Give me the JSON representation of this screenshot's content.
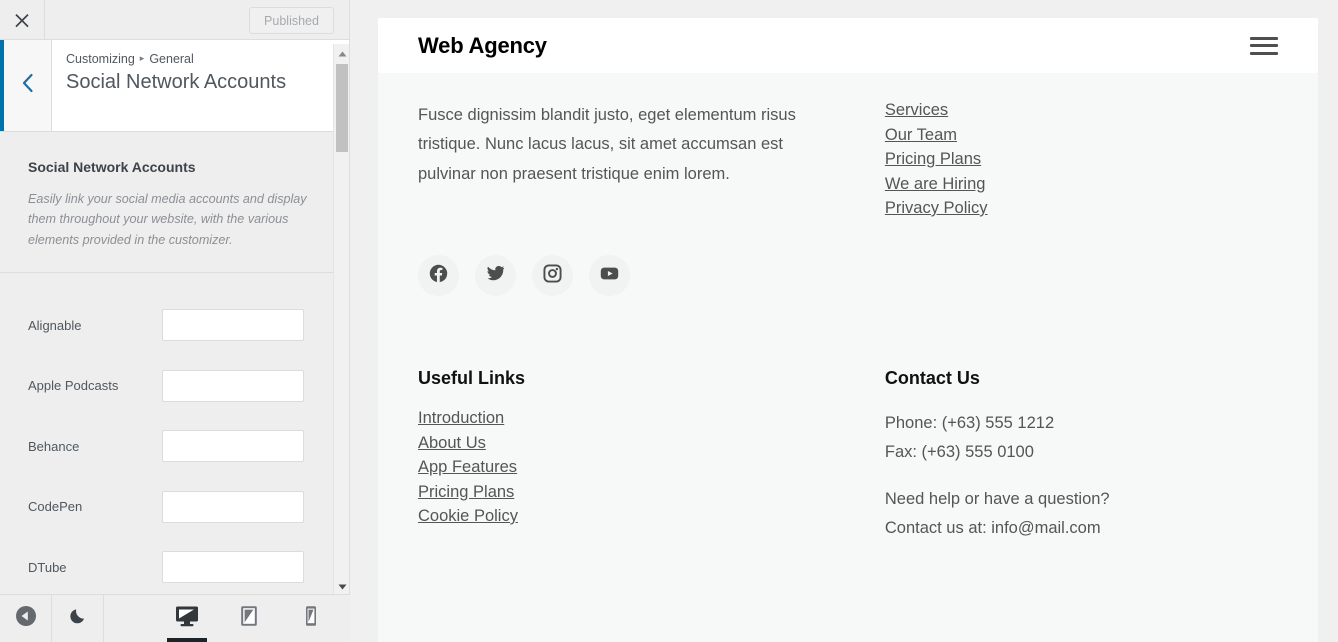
{
  "customizer": {
    "close_label": "close-icon",
    "publish_button": "Published",
    "breadcrumb": {
      "root": "Customizing",
      "separator": "▸",
      "section": "General"
    },
    "panel_title": "Social Network Accounts",
    "description": {
      "heading": "Social Network Accounts",
      "text": "Easily link your social media accounts and display them throughout your website, with the various elements provided in the customizer."
    },
    "fields": [
      {
        "label": "Alignable",
        "value": "",
        "placeholder": ""
      },
      {
        "label": "Apple Podcasts",
        "value": "",
        "placeholder": ""
      },
      {
        "label": "Behance",
        "value": "",
        "placeholder": ""
      },
      {
        "label": "CodePen",
        "value": "",
        "placeholder": ""
      },
      {
        "label": "DTube",
        "value": "",
        "placeholder": ""
      }
    ],
    "bottom_bar": {
      "collapse_label": "Collapse",
      "dark_mode_label": "Dark mode",
      "devices": [
        {
          "name": "Desktop",
          "active": true
        },
        {
          "name": "Tablet",
          "active": false
        },
        {
          "name": "Mobile",
          "active": false
        }
      ]
    },
    "accent_color": "#0073aa"
  },
  "preview": {
    "brand": "Web Agency",
    "menu_label": "Menu",
    "about_paragraph": "Fusce dignissim blandit justo, eget elementum risus tristique. Nunc lacus lacus, sit amet accumsan est pulvinar non praesent tristique enim lorem.",
    "nav_links": [
      "Services",
      "Our Team",
      "Pricing Plans",
      "We are Hiring",
      "Privacy Policy"
    ],
    "socials": [
      {
        "name": "facebook",
        "label": "Facebook"
      },
      {
        "name": "twitter",
        "label": "Twitter"
      },
      {
        "name": "instagram",
        "label": "Instagram"
      },
      {
        "name": "youtube",
        "label": "YouTube"
      }
    ],
    "useful_links": {
      "title": "Useful Links",
      "items": [
        "Introduction",
        "About Us",
        "App Features",
        "Pricing Plans",
        "Cookie Policy"
      ]
    },
    "contact": {
      "title": "Contact Us",
      "phone": "Phone: (+63) 555 1212",
      "fax": "Fax: (+63) 555 0100",
      "question": "Need help or have a question?",
      "email_line": "Contact us at: info@mail.com"
    }
  }
}
